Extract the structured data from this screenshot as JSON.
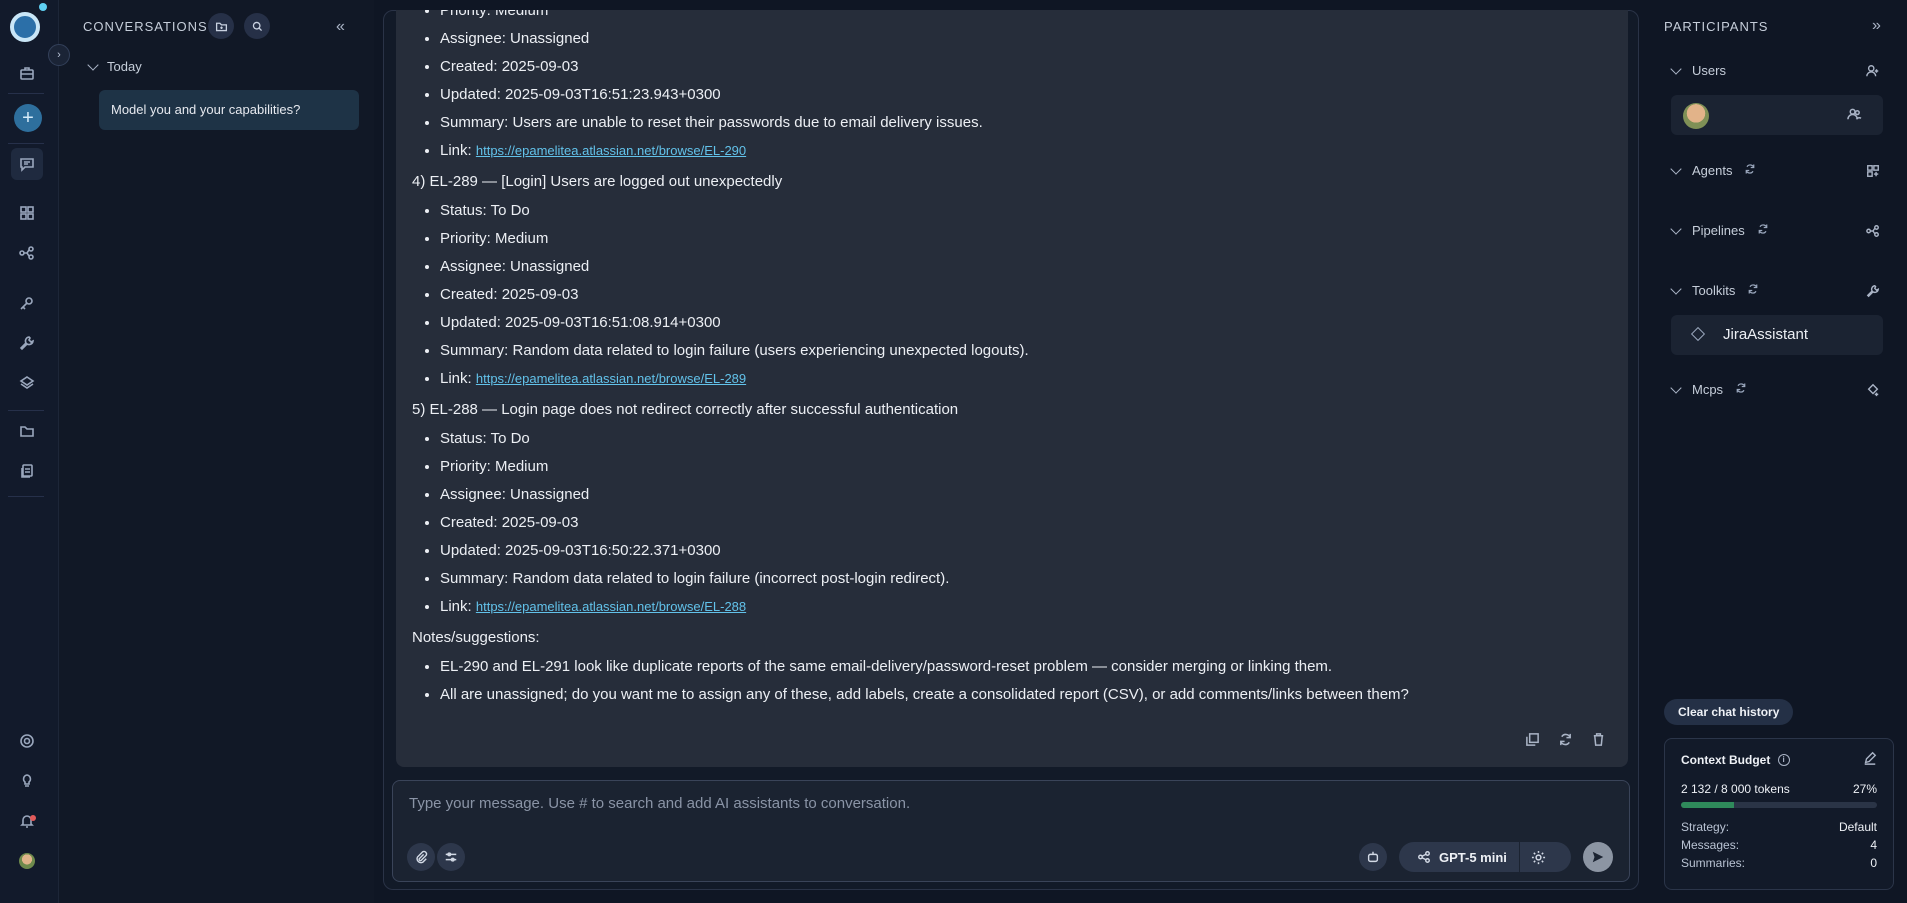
{
  "sidebar": {
    "title": "CONVERSATIONS",
    "group": "Today",
    "items": [
      {
        "label": "Model you and your capabilities?"
      }
    ]
  },
  "message": {
    "top_partial": "Priority: Medium",
    "items": [
      {
        "type": "li",
        "text": "Assignee: Unassigned"
      },
      {
        "type": "li",
        "text": "Created: 2025-09-03"
      },
      {
        "type": "li",
        "text": "Updated: 2025-09-03T16:51:23.943+0300"
      },
      {
        "type": "li",
        "text": "Summary: Users are unable to reset their passwords due to email delivery issues."
      },
      {
        "type": "link",
        "text": "Link: ",
        "url": "https://epamelitea.atlassian.net/browse/EL-290"
      }
    ],
    "issue4": {
      "heading": "4) EL-289 — [Login] Users are logged out unexpectedly",
      "status": "Status: To Do",
      "priority": "Priority: Medium",
      "assignee": "Assignee: Unassigned",
      "created": "Created: 2025-09-03",
      "updated": "Updated: 2025-09-03T16:51:08.914+0300",
      "summary": "Summary: Random data related to login failure (users experiencing unexpected logouts).",
      "link_label": "Link: ",
      "url": "https://epamelitea.atlassian.net/browse/EL-289"
    },
    "issue5": {
      "heading": "5) EL-288 — Login page does not redirect correctly after successful authentication",
      "status": "Status: To Do",
      "priority": "Priority: Medium",
      "assignee": "Assignee: Unassigned",
      "created": "Created: 2025-09-03",
      "updated": "Updated: 2025-09-03T16:50:22.371+0300",
      "summary": "Summary: Random data related to login failure (incorrect post-login redirect).",
      "link_label": "Link: ",
      "url": "https://epamelitea.atlassian.net/browse/EL-288"
    },
    "notes_heading": "Notes/suggestions:",
    "notes": [
      "EL-290 and EL-291 look like duplicate reports of the same email-delivery/password-reset problem — consider merging or linking them.",
      "All are unassigned; do you want me to assign any of these, add labels, create a consolidated report (CSV), or add comments/links between them?"
    ]
  },
  "composer": {
    "placeholder": "Type your message. Use # to search and add AI assistants to conversation.",
    "model": "GPT-5 mini"
  },
  "participants": {
    "title": "PARTICIPANTS",
    "sections": {
      "users": "Users",
      "agents": "Agents",
      "pipelines": "Pipelines",
      "toolkits": "Toolkits",
      "mcps": "Mcps"
    },
    "toolkit_item": "JiraAssistant",
    "clear_label": "Clear chat history"
  },
  "budget": {
    "title": "Context Budget",
    "tokens": "2 132 / 8 000 tokens",
    "percent": "27%",
    "fill": 0.27,
    "strategy_label": "Strategy:",
    "strategy": "Default",
    "messages_label": "Messages:",
    "messages": "4",
    "summaries_label": "Summaries:",
    "summaries": "0"
  },
  "colors": {
    "accent": "#2e6f9d",
    "link": "#62c2ea",
    "budget_fill": "#2f8a5b"
  }
}
